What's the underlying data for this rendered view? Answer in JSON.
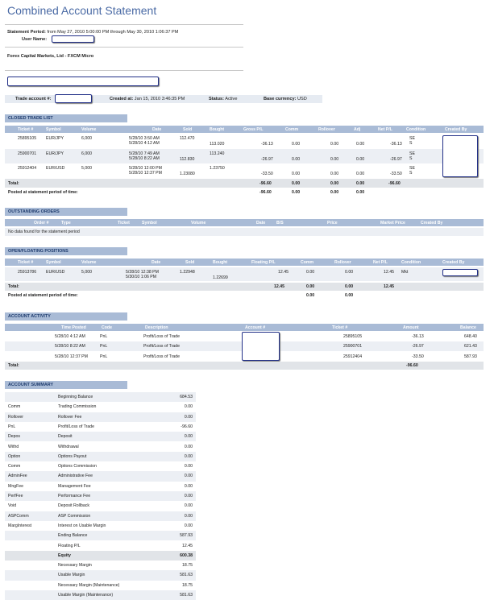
{
  "title": "Combined Account Statement",
  "statement": {
    "period_label": "Statement Period:",
    "period_value": "from May 27, 2010 5:00:00 PM through May 30, 2010 1:06:37 PM",
    "user_label": "User Name:",
    "broker": "Forex Capital Markets, Ltd - FXCM Micro"
  },
  "account_bar": {
    "trade_account_label": "Trade account #:",
    "created_label": "Created at:",
    "created_value": "Jan 15, 2010 3:46:35 PM",
    "status_label": "Status:",
    "status_value": "Active",
    "currency_label": "Base currency:",
    "currency_value": "USD"
  },
  "closed": {
    "header": "CLOSED TRADE LIST",
    "columns": [
      "Ticket #",
      "Symbol",
      "Volume",
      "Date",
      "Sold",
      "Bought",
      "Gross P/L",
      "Comm",
      "Rollover",
      "Adj",
      "Net P/L",
      "Condition",
      "Created By"
    ],
    "rows": [
      {
        "ticket": "25895105",
        "symbol": "EUR/JPY",
        "volume": "6,000",
        "date1": "5/28/10 3:50 AM",
        "date2": "5/28/10 4:12 AM",
        "sold": "112.470",
        "bought": "113.020",
        "gross": "-36.13",
        "comm": "0.00",
        "rollover": "0.00",
        "adj": "0.00",
        "net": "-36.13",
        "cond1": "SE",
        "cond2": "S"
      },
      {
        "ticket": "25900701",
        "symbol": "EUR/JPY",
        "volume": "6,000",
        "date1": "5/28/10 7:49 AM",
        "date2": "5/28/10 8:22 AM",
        "sold": "112.830",
        "bought": "113.240",
        "gross": "-26.97",
        "comm": "0.00",
        "rollover": "0.00",
        "adj": "0.00",
        "net": "-26.97",
        "cond1": "SE",
        "cond2": "S"
      },
      {
        "ticket": "25912404",
        "symbol": "EUR/USD",
        "volume": "5,000",
        "date1": "5/28/10 12:00 PM",
        "date2": "5/28/10 12:37 PM",
        "sold": "1.23080",
        "bought": "1.23750",
        "gross": "-33.50",
        "comm": "0.00",
        "rollover": "0.00",
        "adj": "0.00",
        "net": "-33.50",
        "cond1": "SE",
        "cond2": "S"
      }
    ],
    "total_label": "Total:",
    "total": {
      "gross": "-96.60",
      "comm": "0.00",
      "rollover": "0.00",
      "adj": "0.00",
      "net": "-96.60"
    },
    "posted_label": "Posted at statement period of time:",
    "posted": {
      "gross": "-96.60",
      "comm": "0.00",
      "rollover": "0.00",
      "adj": "0.00"
    }
  },
  "outstanding": {
    "header": "OUTSTANDING ORDERS",
    "columns": [
      "Order #",
      "Type",
      "Ticket",
      "Symbol",
      "Volume",
      "Date",
      "B/S",
      "Price",
      "Market Price",
      "Created By"
    ],
    "empty": "No data found for the statement period"
  },
  "open": {
    "header": "OPEN/FLOATING POSITIONS",
    "columns": [
      "Ticket #",
      "Symbol",
      "Volume",
      "Date",
      "Sold",
      "Bought",
      "Floating P/L",
      "Comm",
      "Rollover",
      "Net P/L",
      "Condition",
      "Created By"
    ],
    "row": {
      "ticket": "25913786",
      "symbol": "EUR/USD",
      "volume": "5,000",
      "date1": "5/28/10 12:38 PM",
      "date2": "5/30/10 1:06 PM",
      "sold": "1.22948",
      "bought": "1.22699",
      "floating": "12.45",
      "comm": "0.00",
      "rollover": "0.00",
      "net": "12.45",
      "cond": "Mkt"
    },
    "total_label": "Total:",
    "total": {
      "floating": "12.45",
      "comm": "0.00",
      "rollover": "0.00",
      "net": "12.45"
    },
    "posted_label": "Posted at statement period of time:",
    "posted": {
      "comm": "0.00",
      "rollover": "0.00"
    }
  },
  "activity": {
    "header": "ACCOUNT ACTIVITY",
    "columns": [
      "Time Posted",
      "Code",
      "Description",
      "Account #",
      "Ticket #",
      "Amount",
      "Balance"
    ],
    "rows": [
      {
        "time": "5/28/10 4:12 AM",
        "code": "PnL",
        "desc": "Profit/Loss of Trade",
        "ticket": "25895105",
        "amount": "-36.13",
        "balance": "648.40"
      },
      {
        "time": "5/28/10 8:22 AM",
        "code": "PnL",
        "desc": "Profit/Loss of Trade",
        "ticket": "25900701",
        "amount": "-26.97",
        "balance": "621.43"
      },
      {
        "time": "5/28/10 12:37 PM",
        "code": "PnL",
        "desc": "Profit/Loss of Trade",
        "ticket": "25912404",
        "amount": "-33.50",
        "balance": "587.93"
      }
    ],
    "total_label": "Total:",
    "total": "-96.60"
  },
  "summary": {
    "header": "ACCOUNT SUMMARY",
    "rows": [
      {
        "code": "",
        "label": "Beginning Balance",
        "value": "684.53"
      },
      {
        "code": "Comm",
        "label": "Trading Commission",
        "value": "0.00"
      },
      {
        "code": "Rollover",
        "label": "Rollover Fee",
        "value": "0.00"
      },
      {
        "code": "PnL",
        "label": "Profit/Loss of Trade",
        "value": "-96.60"
      },
      {
        "code": "Depos",
        "label": "Deposit",
        "value": "0.00"
      },
      {
        "code": "Withd",
        "label": "Withdrawal",
        "value": "0.00"
      },
      {
        "code": "Option",
        "label": "Options Payout",
        "value": "0.00"
      },
      {
        "code": "Comm",
        "label": "Options Commission",
        "value": "0.00"
      },
      {
        "code": "AdminFee",
        "label": "Administrative Fee",
        "value": "0.00"
      },
      {
        "code": "MngFee",
        "label": "Management Fee",
        "value": "0.00"
      },
      {
        "code": "PerfFee",
        "label": "Performance Fee",
        "value": "0.00"
      },
      {
        "code": "Void",
        "label": "Deposit Rollback",
        "value": "0.00"
      },
      {
        "code": "ASPComm",
        "label": "ASP Commission",
        "value": "0.00"
      },
      {
        "code": "MargInterest",
        "label": "Interest on Usable Margin",
        "value": "0.00"
      },
      {
        "code": "",
        "label": "Ending Balance",
        "value": "587.93"
      },
      {
        "code": "",
        "label": "Floating P/L",
        "value": "12.45"
      },
      {
        "code": "",
        "label": "Equity",
        "value": "600.38"
      },
      {
        "code": "",
        "label": "Necessary Margin",
        "value": "18.75"
      },
      {
        "code": "",
        "label": "Usable Margin",
        "value": "581.63"
      },
      {
        "code": "",
        "label": "Necessary Margin (Maintenance)",
        "value": "18.75"
      },
      {
        "code": "",
        "label": "Usable Margin (Maintenance)",
        "value": "581.63"
      }
    ]
  }
}
